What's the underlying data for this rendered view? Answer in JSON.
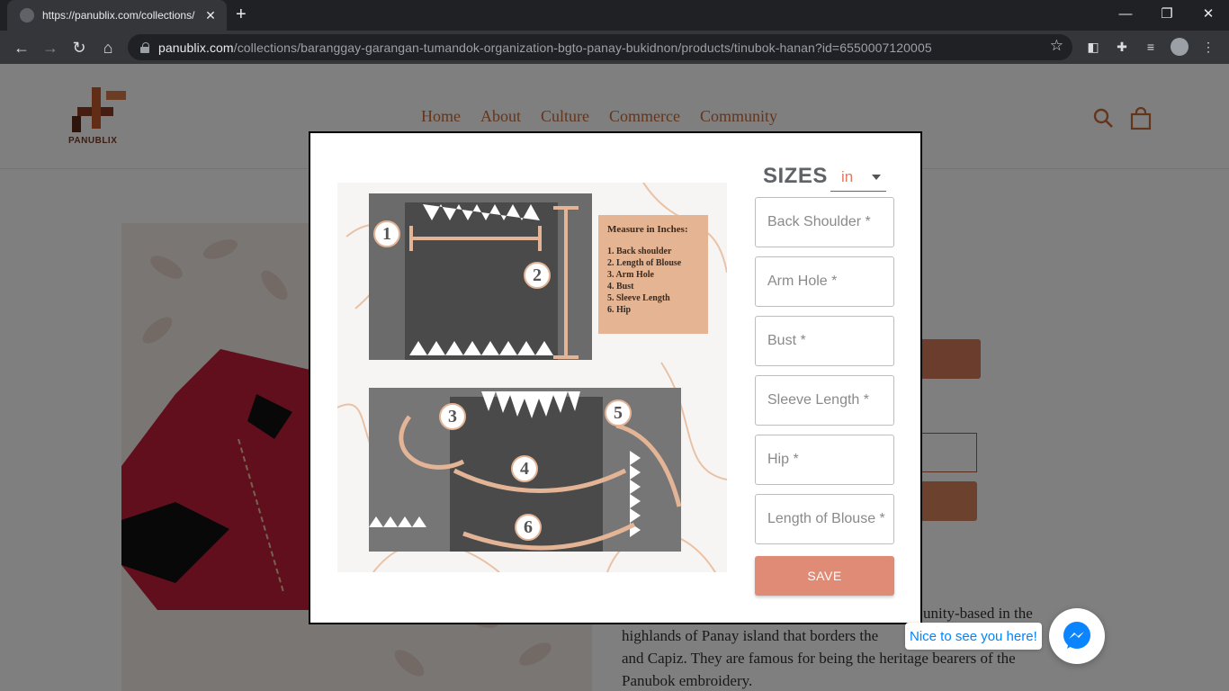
{
  "browser": {
    "tab_title": "https://panublix.com/collections/",
    "tab_close": "✕",
    "new_tab": "+",
    "url_host": "panublix.com",
    "url_path": "/collections/baranggay-garangan-tumandok-organization-bgto-panay-bukidnon/products/tinubok-hanan?id=6550007120005",
    "icons": [
      "back-icon",
      "forward-icon",
      "reload-icon",
      "home-icon",
      "lock-icon",
      "star-icon",
      "extension-icon",
      "puzzle-icon",
      "media-icon",
      "profile-icon",
      "menu-icon"
    ]
  },
  "site": {
    "logo_text": "PANUBLIX",
    "nav": [
      "Home",
      "About",
      "Culture",
      "Commerce",
      "Community"
    ],
    "description_lines": [
      "unity-based in the",
      "highlands of Panay island that borders the",
      "and Capiz. They are famous for being the heritage bearers of the",
      "Panubok embroidery."
    ]
  },
  "modal": {
    "title": "SIZES",
    "unit": "in",
    "guide": {
      "heading": "Measure in Inches:",
      "items": [
        "1. Back shoulder",
        "2. Length of Blouse",
        "3. Arm Hole",
        "4. Bust",
        "5. Sleeve Length",
        "6. Hip"
      ],
      "markers": [
        "1",
        "2",
        "3",
        "4",
        "5",
        "6"
      ]
    },
    "fields": [
      "Back Shoulder *",
      "Arm Hole *",
      "Bust *",
      "Sleeve Length *",
      "Hip *",
      "Length of Blouse *"
    ],
    "save_label": "SAVE"
  },
  "chat": {
    "greeting": "Nice to see you here!"
  },
  "colors": {
    "accent": "#e08b76",
    "brand": "#c96a3a",
    "guide_peach": "#e4b493",
    "messenger": "#0084ff"
  }
}
